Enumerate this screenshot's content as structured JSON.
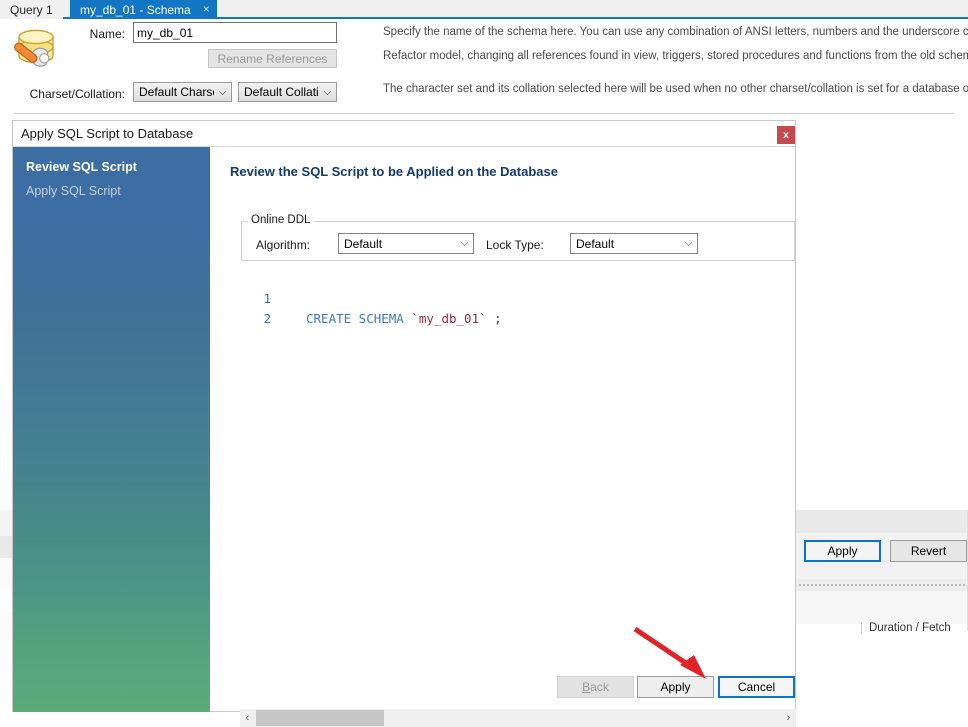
{
  "window": {
    "tabs": [
      {
        "label": "Query 1",
        "active": false
      },
      {
        "label": "my_db_01 - Schema",
        "active": true,
        "close": "×"
      }
    ]
  },
  "schema_editor": {
    "icon": "database-wrench-icon",
    "name_label": "Name:",
    "name_value": "my_db_01",
    "rename_references_label": "Rename References",
    "charset_label": "Charset/Collation:",
    "charset_value": "Default Charset",
    "collation_value": "Default Collation",
    "hints": {
      "name": "Specify the name of the schema here. You can use any combination of ANSI letters, numbers and the underscore character",
      "rename": "Refactor model, changing all references found in view, triggers, stored procedures and functions from the old schema name to the new",
      "charset": "The character set and its collation selected here will be used when no other charset/collation is set for a database object (it"
    }
  },
  "background_panel": {
    "apply_label": "Apply",
    "revert_label": "Revert",
    "duration_fetch_label": "Duration / Fetch"
  },
  "dialog": {
    "title": "Apply SQL Script to Database",
    "close_label": "x",
    "heading": "Review the SQL Script to be Applied on the Database",
    "steps": [
      {
        "label": "Review SQL Script",
        "active": true
      },
      {
        "label": "Apply SQL Script",
        "active": false
      }
    ],
    "online_ddl": {
      "legend": "Online DDL",
      "algorithm_label": "Algorithm:",
      "algorithm_value": "Default",
      "lock_type_label": "Lock Type:",
      "lock_type_value": "Default"
    },
    "sql": {
      "lines": [
        {
          "number": "1",
          "keyword": "CREATE SCHEMA",
          "identifier": "`my_db_01`",
          "terminator": ";"
        },
        {
          "number": "2",
          "keyword": "",
          "identifier": "",
          "terminator": ""
        }
      ],
      "full_text": "CREATE SCHEMA `my_db_01` ;"
    },
    "scrollbar": {
      "left_arrow": "‹",
      "right_arrow": "›"
    },
    "buttons": {
      "back_label": "Back",
      "back_accel": "B",
      "back_rest": "ack",
      "apply_label": "Apply",
      "cancel_label": "Cancel"
    }
  },
  "colors": {
    "accent_blue": "#1276c4",
    "focus_blue": "#0c73c8",
    "close_red": "#c54a4f",
    "heading_navy": "#123a6c",
    "sql_keyword": "#3a79c4",
    "sql_identifier": "#9c2a3a",
    "annotation_red": "#e32227"
  }
}
